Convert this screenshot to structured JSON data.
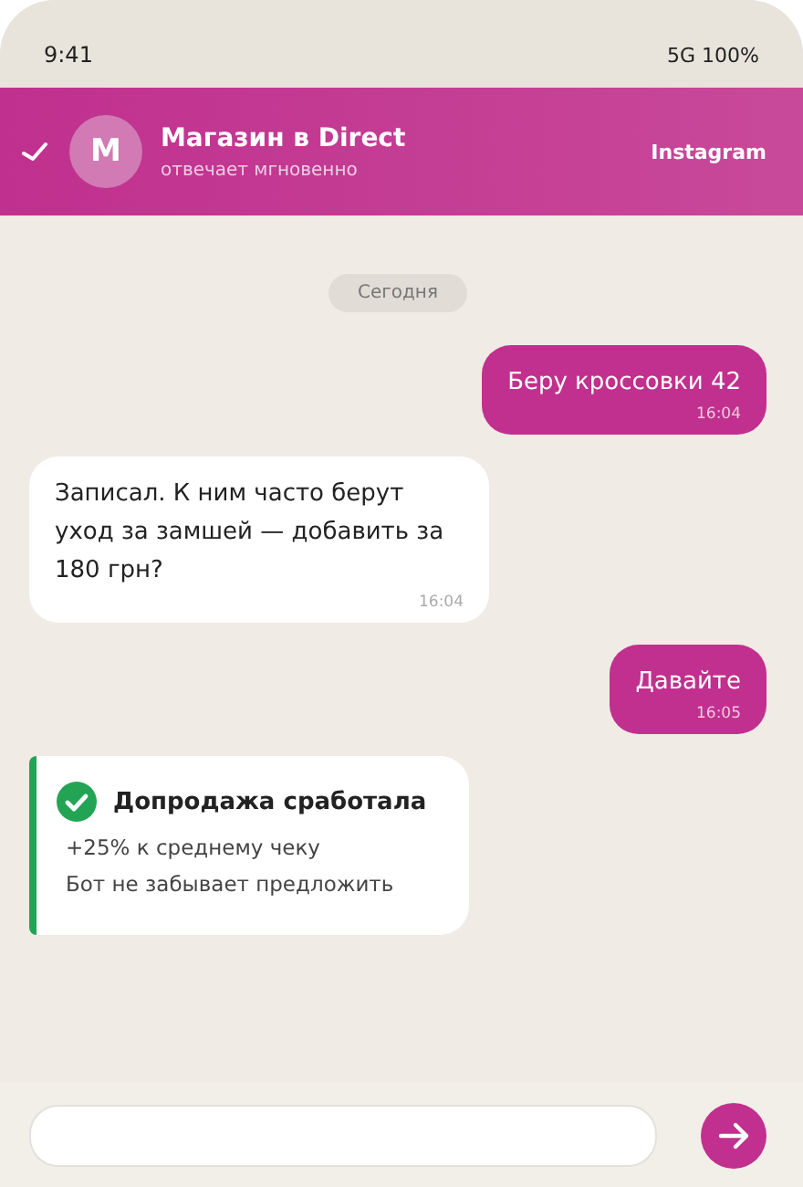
{
  "status_bar": {
    "time": "9:41",
    "indicators": "5G 100%"
  },
  "header": {
    "avatar": "М",
    "title": "Магазин в Direct",
    "subtitle": "отвечает мгновенно",
    "platform": "Instagram"
  },
  "date_chip": "Сегодня",
  "messages": [
    {
      "kind": "outgoing",
      "text": "Беру кроссовки 42",
      "time": "16:04"
    },
    {
      "kind": "incoming",
      "text": "Записал. К ним часто берут уход за замшей — добавить за 180 грн?",
      "time": "16:04"
    },
    {
      "kind": "outgoing",
      "text": "Давайте",
      "time": "16:05"
    },
    {
      "kind": "result",
      "title": "Допродажа сработала",
      "lines": [
        "+25% к среднему чеку",
        "Бот не забывает предложить"
      ]
    }
  ]
}
